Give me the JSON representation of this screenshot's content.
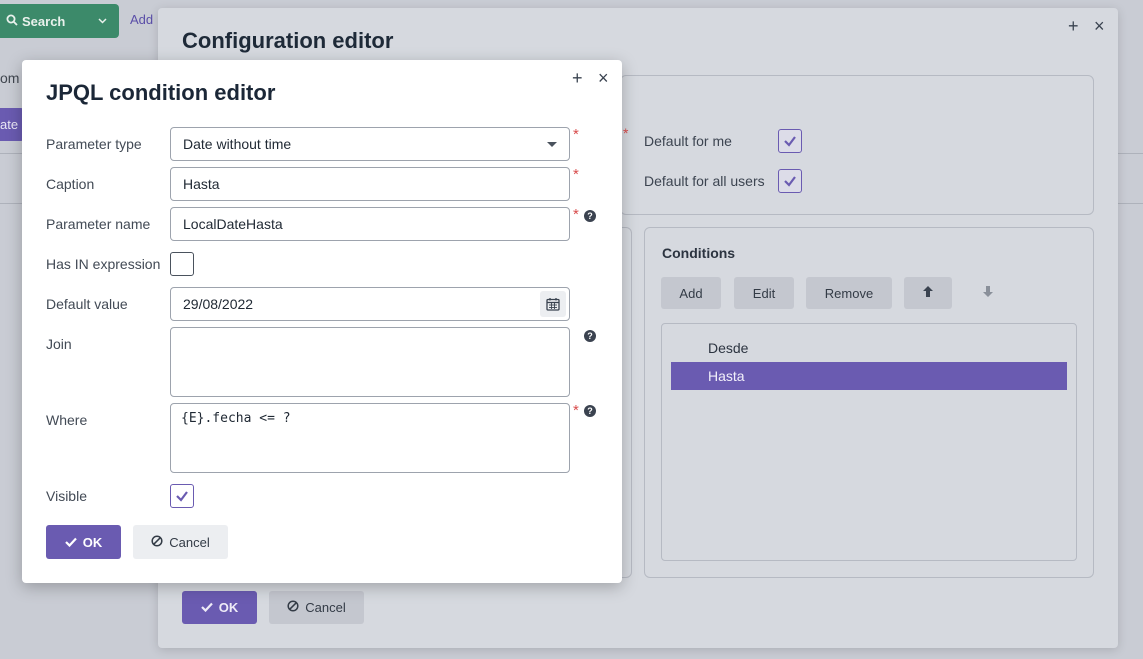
{
  "background": {
    "search_label": "Search",
    "add_label": "Add",
    "partial_text": "om",
    "partial_button": "ate"
  },
  "config_editor": {
    "title": "Configuration editor",
    "default_for_me_label": "Default for me",
    "default_for_me_checked": true,
    "default_for_all_label": "Default for all users",
    "default_for_all_checked": true,
    "conditions": {
      "title": "Conditions",
      "buttons": {
        "add": "Add",
        "edit": "Edit",
        "remove": "Remove"
      },
      "items": [
        "Desde",
        "Hasta"
      ],
      "selected": "Hasta"
    },
    "ok_label": "OK",
    "cancel_label": "Cancel"
  },
  "jpql_editor": {
    "title": "JPQL condition editor",
    "fields": {
      "parameter_type": {
        "label": "Parameter type",
        "value": "Date without time"
      },
      "caption": {
        "label": "Caption",
        "value": "Hasta"
      },
      "parameter_name": {
        "label": "Parameter name",
        "value": "LocalDateHasta"
      },
      "has_in_expression": {
        "label": "Has IN expression",
        "checked": false
      },
      "default_value": {
        "label": "Default value",
        "value": "29/08/2022"
      },
      "join": {
        "label": "Join",
        "value": ""
      },
      "where": {
        "label": "Where",
        "value": "{E}.fecha <= ?"
      },
      "visible": {
        "label": "Visible",
        "checked": true
      }
    },
    "required_marker": "*",
    "help_marker": "?",
    "ok_label": "OK",
    "cancel_label": "Cancel"
  },
  "colors": {
    "accent": "#6a5bb1",
    "search_green": "#3c8a6a",
    "required": "#d84b4b"
  }
}
